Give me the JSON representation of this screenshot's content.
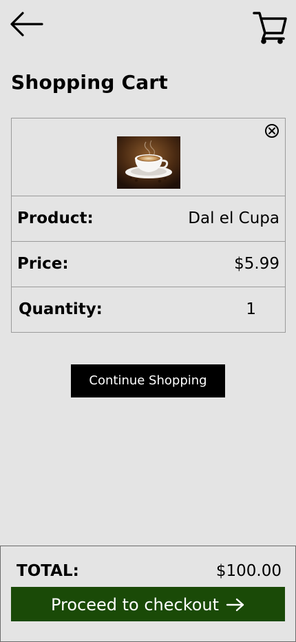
{
  "header": {
    "back_icon": "arrow-left-icon",
    "cart_icon": "shopping-cart-icon"
  },
  "page": {
    "title": "Shopping Cart"
  },
  "cart_item": {
    "remove_icon": "close-circle-icon",
    "image": "coffee-cup-image",
    "product_label": "Product:",
    "product_value": "Dal el Cupa",
    "price_label": "Price:",
    "price_value": "$5.99",
    "quantity_label": "Quantity:",
    "quantity_value": "1"
  },
  "actions": {
    "continue_label": "Continue Shopping"
  },
  "footer": {
    "total_label": "TOTAL:",
    "total_value": "$100.00",
    "checkout_label": "Proceed to checkout",
    "checkout_icon": "arrow-right-icon"
  },
  "colors": {
    "background": "#e4e4e4",
    "checkout_button": "#1a4a07",
    "continue_button": "#000000"
  }
}
